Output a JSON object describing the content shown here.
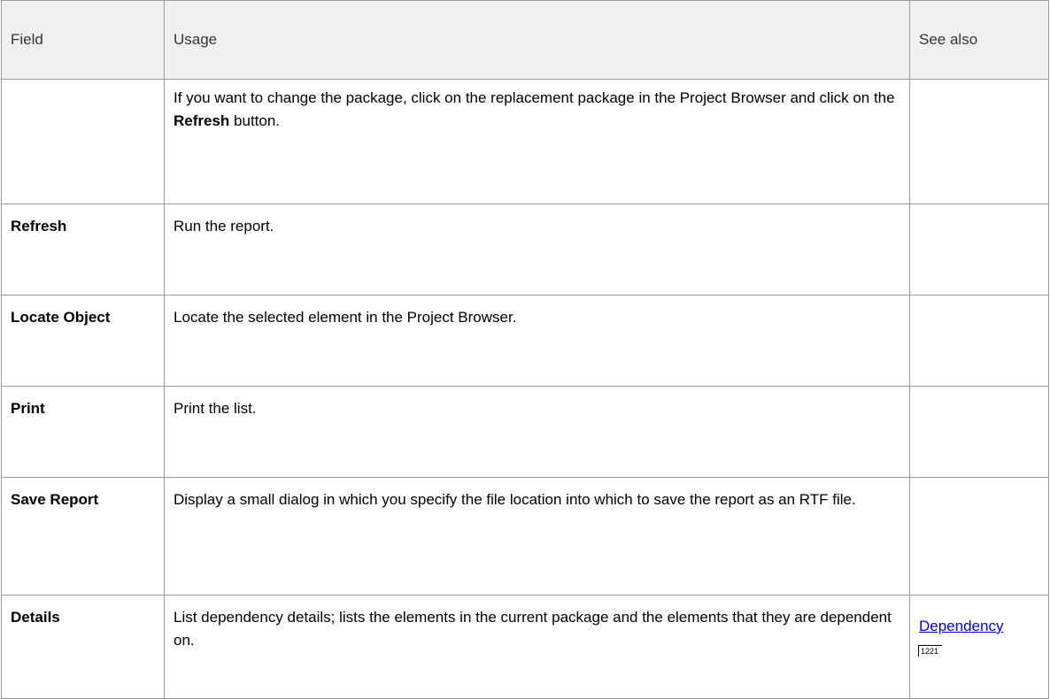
{
  "table": {
    "headers": {
      "field": "Field",
      "usage": "Usage",
      "see_also": "See also"
    },
    "rows": [
      {
        "field": "",
        "usage_parts": {
          "before": "If you want to change the package, click on the replacement package in the Project Browser and click on the ",
          "bold": "Refresh",
          "after": " button."
        },
        "see_also": ""
      },
      {
        "field": "Refresh",
        "usage": "Run the report.",
        "see_also": ""
      },
      {
        "field": "Locate Object",
        "usage": "Locate the selected element in the Project Browser.",
        "see_also": ""
      },
      {
        "field": "Print",
        "usage": "Print the list.",
        "see_also": ""
      },
      {
        "field": "Save Report",
        "usage": "Display a small dialog in which you specify the file location into which to save the report as an RTF file.",
        "see_also": ""
      },
      {
        "field": "Details",
        "usage": "List dependency details; lists the elements in the current package and the elements that they are dependent on.",
        "see_also": {
          "link": "Dependency",
          "page": "1221"
        }
      }
    ]
  }
}
